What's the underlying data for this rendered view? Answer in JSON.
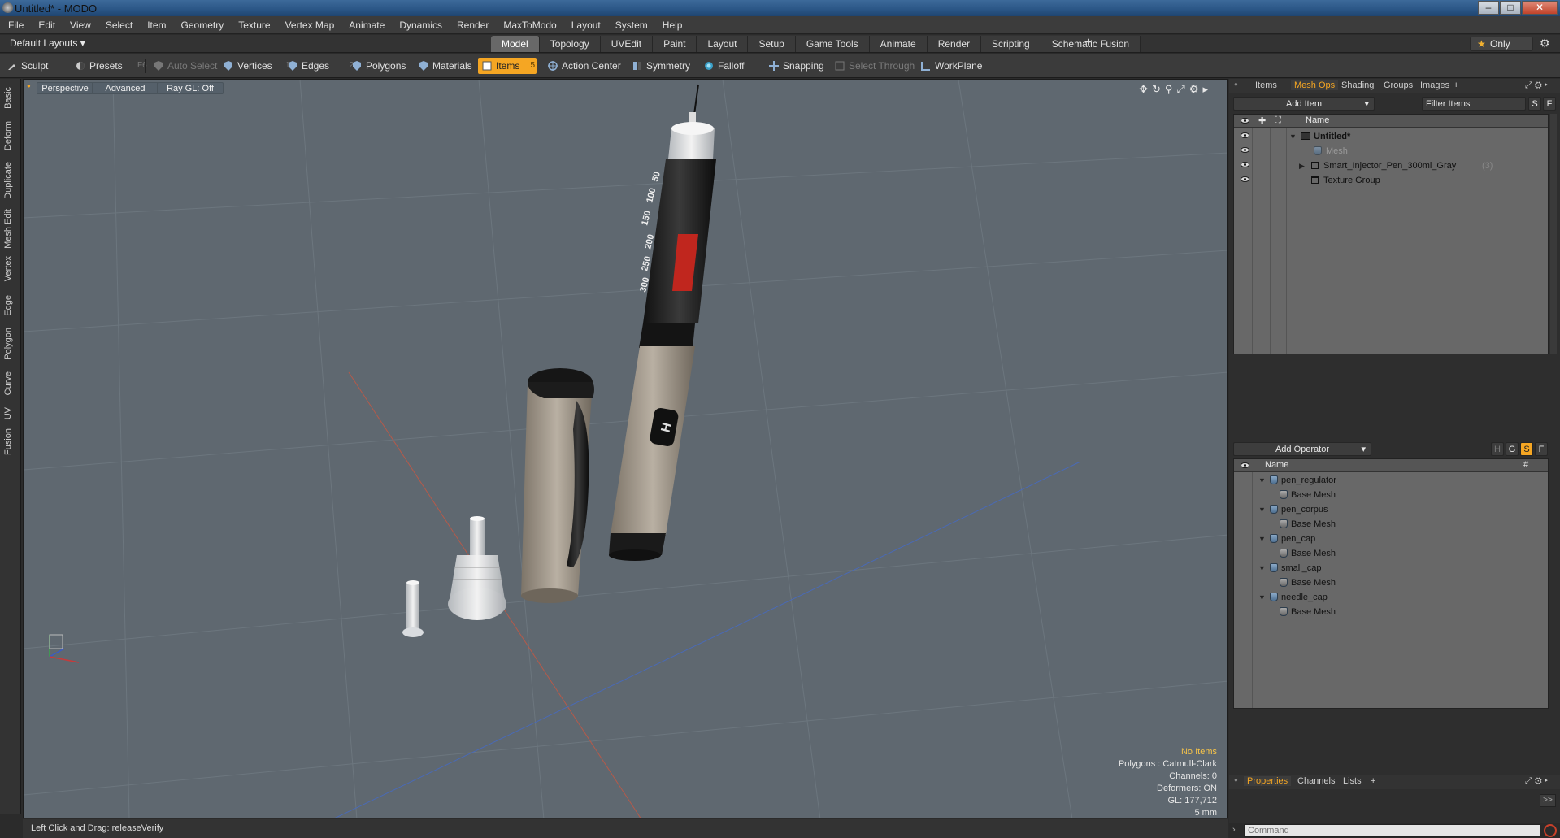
{
  "window": {
    "title": "Untitled* - MODO",
    "minimize": "‒",
    "maximize": "□",
    "close": "✕"
  },
  "menu": [
    "File",
    "Edit",
    "View",
    "Select",
    "Item",
    "Geometry",
    "Texture",
    "Vertex Map",
    "Animate",
    "Dynamics",
    "Render",
    "MaxToModo",
    "Layout",
    "System",
    "Help"
  ],
  "layout": {
    "selector": "Default Layouts ▾",
    "tabs": [
      "Model",
      "Topology",
      "UVEdit",
      "Paint",
      "Layout",
      "Setup",
      "Game Tools",
      "Animate",
      "Render",
      "Scripting",
      "Schematic Fusion"
    ],
    "active_tab": "Model",
    "add": "+",
    "only_label": "Only"
  },
  "toolbar": {
    "sculpt": "Sculpt",
    "presets": "Presets",
    "presets_key": "F6",
    "auto_select": "Auto Select",
    "vertices": "Vertices",
    "vertices_key": "1",
    "edges": "Edges",
    "edges_key": "2",
    "polygons": "Polygons",
    "materials": "Materials",
    "items": "Items",
    "items_key": "5",
    "action_center": "Action Center",
    "symmetry": "Symmetry",
    "falloff": "Falloff",
    "snapping": "Snapping",
    "select_through": "Select Through",
    "workplane": "WorkPlane"
  },
  "left_tabs": [
    "Basic",
    "Deform",
    "Duplicate",
    "Mesh Edit",
    "Vertex",
    "Edge",
    "Polygon",
    "Curve",
    "UV",
    "Fusion"
  ],
  "viewport": {
    "view": "Perspective",
    "shading": "Advanced",
    "raygl": "Ray GL: Off",
    "info": {
      "no_items": "No Items",
      "polygons": "Polygons : Catmull-Clark",
      "channels": "Channels: 0",
      "deformers": "Deformers: ON",
      "gl": "GL: 177,712",
      "unit": "5 mm"
    },
    "pen_scale": [
      "50",
      "100",
      "150",
      "200",
      "250",
      "300"
    ]
  },
  "status": {
    "text": "Left Click and Drag:  releaseVerify"
  },
  "items_panel": {
    "tabs": [
      "Items",
      "Mesh Ops",
      "Shading",
      "Groups",
      "Images"
    ],
    "active_tab": "Mesh Ops",
    "add_item": "Add Item",
    "filter": "Filter Items",
    "btn_s": "S",
    "btn_f": "F",
    "col_name": "Name",
    "rows": [
      {
        "label": "Untitled*"
      },
      {
        "label": "Mesh"
      },
      {
        "label": "Smart_Injector_Pen_300ml_Gray",
        "count": "(3)"
      },
      {
        "label": "Texture Group"
      }
    ]
  },
  "operators_panel": {
    "add_operator": "Add Operator",
    "btn_h": "H",
    "btn_g": "G",
    "btn_s": "S",
    "btn_f": "F",
    "col_name": "Name",
    "col_hash": "#",
    "rows": [
      {
        "label": "pen_regulator",
        "child": "Base Mesh"
      },
      {
        "label": "pen_corpus",
        "child": "Base Mesh"
      },
      {
        "label": "pen_cap",
        "child": "Base Mesh"
      },
      {
        "label": "small_cap",
        "child": "Base Mesh"
      },
      {
        "label": "needle_cap",
        "child": "Base Mesh"
      }
    ]
  },
  "properties_panel": {
    "tabs": [
      "Properties",
      "Channels",
      "Lists"
    ],
    "active_tab": "Properties",
    "expand": ">>"
  },
  "command": {
    "placeholder": "Command"
  },
  "colors": {
    "accent": "#f5a623",
    "viewport_bg": "#5f6870",
    "panel_list": "#686868"
  }
}
